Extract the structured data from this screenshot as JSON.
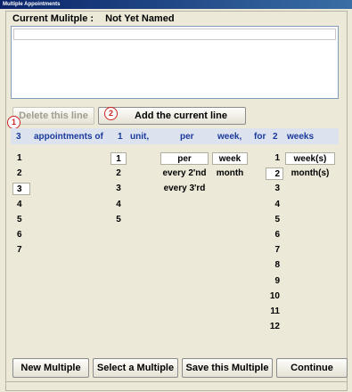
{
  "window": {
    "title": "Multiple Appointments"
  },
  "current": {
    "label": "Current Mulitple :",
    "name": "Not Yet Named"
  },
  "buttons": {
    "delete_line": "Delete this line",
    "add_line": "Add the current line",
    "new_multiple": "New Multiple",
    "select_multiple": "Select a Multiple",
    "save_multiple": "Save this Multiple",
    "continue": "Continue"
  },
  "badges": {
    "one": "1",
    "two": "2"
  },
  "header": {
    "count": "3",
    "appointments_of": "appointments of",
    "unit_count": "1",
    "unit": "unit,",
    "per": "per",
    "period": "week,",
    "for": "for",
    "duration": "2",
    "duration_unit": "weeks"
  },
  "lists": {
    "appointments": [
      "1",
      "2",
      "3",
      "4",
      "5",
      "6",
      "7"
    ],
    "appointments_selected": "3",
    "units": [
      "1",
      "2",
      "3",
      "4",
      "5"
    ],
    "units_selected": "1",
    "per": [
      "per",
      "every 2'nd",
      "every 3'rd"
    ],
    "per_selected": "per",
    "period": [
      "week",
      "month"
    ],
    "period_selected": "week",
    "duration": [
      "1",
      "2",
      "3",
      "4",
      "5",
      "6",
      "7",
      "8",
      "9",
      "10",
      "11",
      "12"
    ],
    "duration_selected": "2",
    "duration_unit": [
      "week(s)",
      "month(s)"
    ],
    "duration_unit_selected": "week(s)"
  },
  "colors": {
    "header_text": "#1a3a9c",
    "badge": "#cc2222",
    "titlebar": "#0A246A"
  }
}
